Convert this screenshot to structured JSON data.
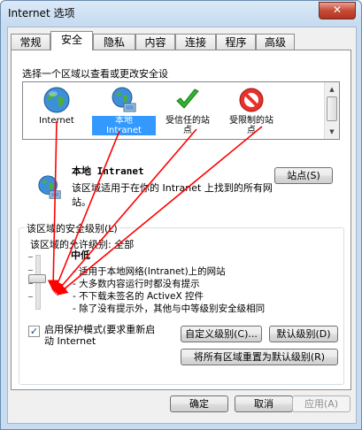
{
  "window": {
    "title": "Internet 选项",
    "close_label": "✕"
  },
  "tabs": [
    {
      "label": "常规"
    },
    {
      "label": "安全"
    },
    {
      "label": "隐私"
    },
    {
      "label": "内容"
    },
    {
      "label": "连接"
    },
    {
      "label": "程序"
    },
    {
      "label": "高级"
    }
  ],
  "zones": {
    "heading": "选择一个区域以查看或更改安全设",
    "items": [
      {
        "label_line1": "Internet",
        "label_line2": "",
        "icon": "globe-icon"
      },
      {
        "label_line1": "本地",
        "label_line2": "Intranet",
        "icon": "network-globe-icon"
      },
      {
        "label_line1": "受信任的站",
        "label_line2": "点",
        "icon": "check-icon"
      },
      {
        "label_line1": "受限制的站",
        "label_line2": "点",
        "icon": "no-entry-icon"
      }
    ]
  },
  "detail": {
    "title": "本地 Intranet",
    "description": "该区域适用于在你的 Intranet 上找到的所有网站。",
    "sites_button": "站点(S)"
  },
  "security": {
    "group_label": "该区域的安全级别(L)",
    "allowed_levels": "该区域的允许级别: 全部",
    "level_name": "中低",
    "level_desc": [
      "- 适用于本地网络(Intranet)上的网站",
      "- 大多数内容运行时都没有提示",
      "- 不下载未签名的 ActiveX 控件",
      "- 除了没有提示外，其他与中等级别安全级相同"
    ],
    "protected_mode": "启用保护模式(要求重新启动 Internet",
    "protected_mode_checked": true,
    "custom_button": "自定义级别(C)...",
    "default_button": "默认级别(D)",
    "reset_all_button": "将所有区域重置为默认级别(R)"
  },
  "footer": {
    "ok": "确定",
    "cancel": "取消",
    "apply": "应用(A)"
  },
  "colors": {
    "selection": "#3399ff",
    "arrow": "#ff0000"
  }
}
